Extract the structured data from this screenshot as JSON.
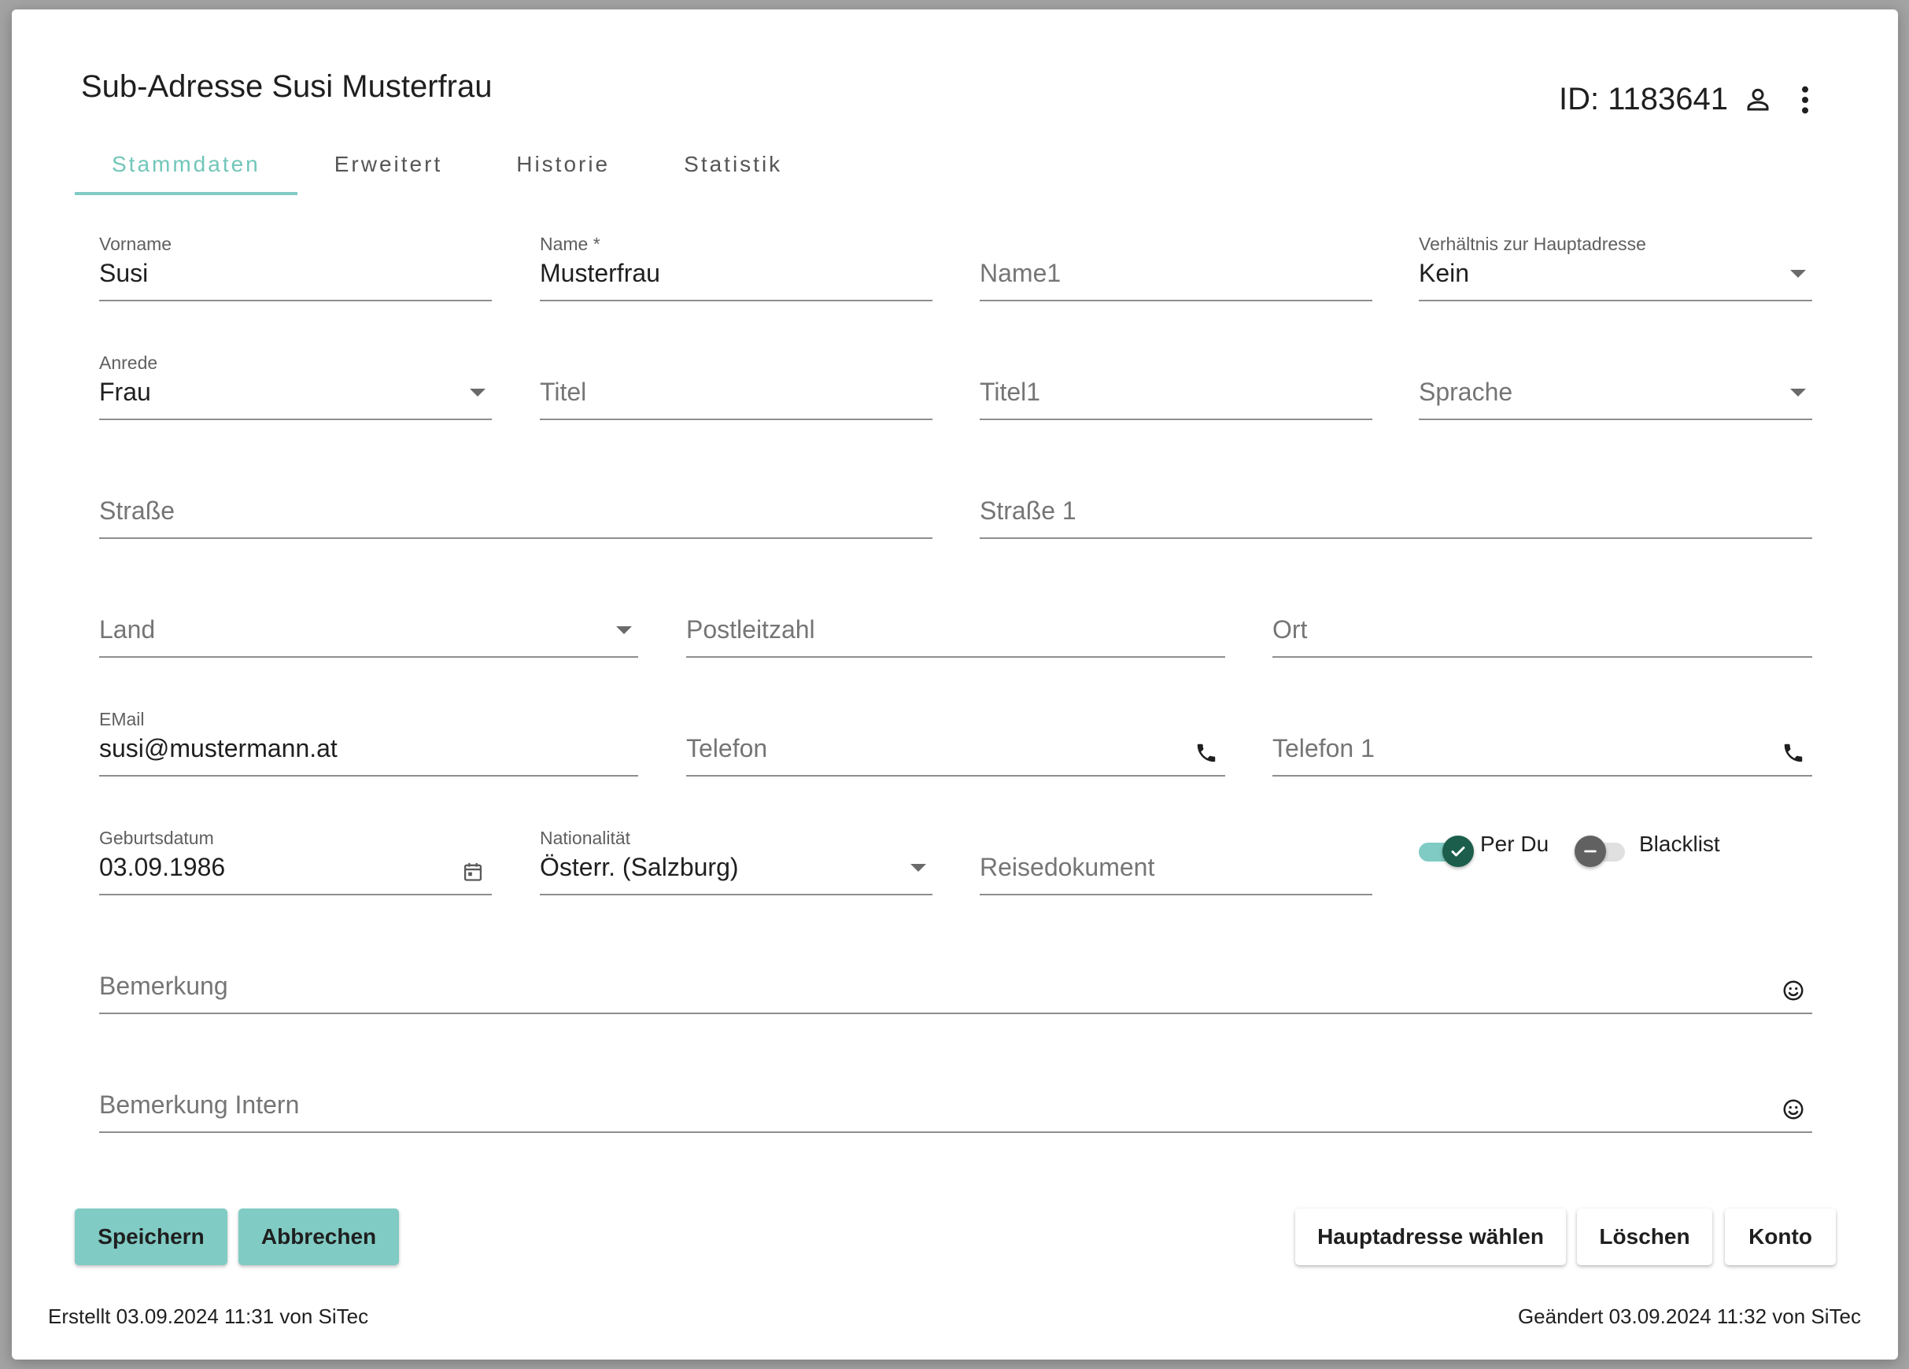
{
  "dialog": {
    "title": "Sub-Adresse Susi Musterfrau",
    "id_text": "ID: 1183641"
  },
  "tabs": [
    "Stammdaten",
    "Erweitert",
    "Historie",
    "Statistik"
  ],
  "fields": {
    "vorname": {
      "label": "Vorname",
      "value": "Susi"
    },
    "name": {
      "label": "Name *",
      "value": "Musterfrau"
    },
    "name1": {
      "placeholder": "Name1"
    },
    "verhaeltnis": {
      "label": "Verhältnis zur Hauptadresse",
      "value": "Kein"
    },
    "anrede": {
      "label": "Anrede",
      "value": "Frau"
    },
    "titel": {
      "placeholder": "Titel"
    },
    "titel1": {
      "placeholder": "Titel1"
    },
    "sprache": {
      "placeholder": "Sprache"
    },
    "strasse": {
      "placeholder": "Straße"
    },
    "strasse1": {
      "placeholder": "Straße 1"
    },
    "land": {
      "placeholder": "Land"
    },
    "plz": {
      "placeholder": "Postleitzahl"
    },
    "ort": {
      "placeholder": "Ort"
    },
    "email": {
      "label": "EMail",
      "value": "susi@mustermann.at"
    },
    "telefon": {
      "placeholder": "Telefon"
    },
    "telefon1": {
      "placeholder": "Telefon 1"
    },
    "geburtsdatum": {
      "label": "Geburtsdatum",
      "value": "03.09.1986"
    },
    "nationalitaet": {
      "label": "Nationalität",
      "value": "Österr. (Salzburg)"
    },
    "reisedokument": {
      "placeholder": "Reisedokument"
    },
    "bemerkung": {
      "placeholder": "Bemerkung"
    },
    "bemerkung_intern": {
      "placeholder": "Bemerkung Intern"
    }
  },
  "toggles": {
    "per_du": {
      "label": "Per Du",
      "checked": true
    },
    "blacklist": {
      "label": "Blacklist",
      "checked": false
    }
  },
  "buttons": {
    "save": "Speichern",
    "cancel": "Abbrechen",
    "choose_main": "Hauptadresse wählen",
    "delete": "Löschen",
    "account": "Konto"
  },
  "footer": {
    "created": "Erstellt 03.09.2024 11:31 von SiTec",
    "changed": "Geändert 03.09.2024 11:32 von SiTec"
  },
  "colors": {
    "accent": "#80cbc4",
    "accent_text": "#71c6b9",
    "toggle_on_knob": "#1b5e4b"
  },
  "icons": [
    "person-icon",
    "more-vert-icon",
    "dropdown-caret-icon",
    "phone-icon",
    "calendar-icon",
    "emoji-icon",
    "check-icon",
    "minus-icon"
  ]
}
